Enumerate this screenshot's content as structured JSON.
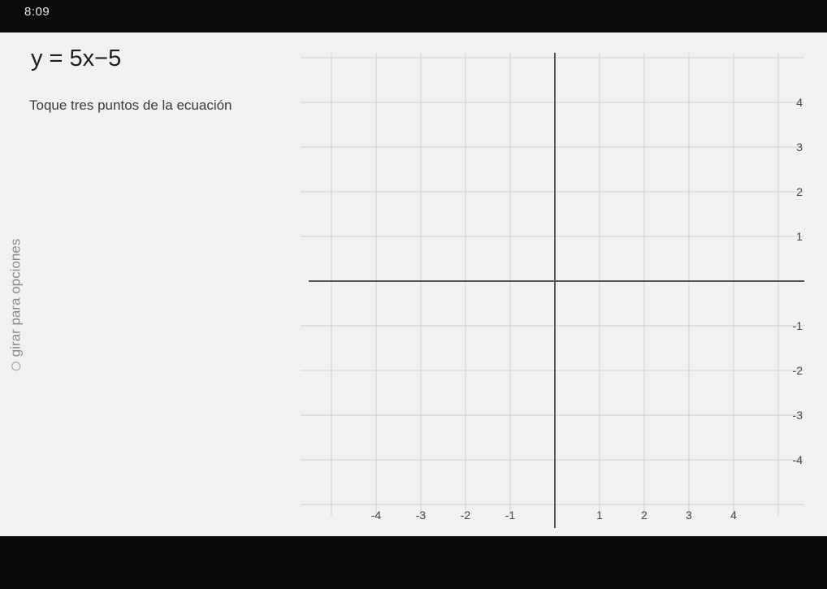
{
  "status_bar": {
    "time": "8:09"
  },
  "problem": {
    "equation": "y = 5x−5",
    "instruction": "Toque tres puntos de la ecuación"
  },
  "hint": {
    "rotate": "girar para opciones",
    "icon": "circle-icon"
  },
  "graph": {
    "x_ticks": [
      "-4",
      "-3",
      "-2",
      "-1",
      "1",
      "2",
      "3",
      "4"
    ],
    "y_ticks": [
      "4",
      "3",
      "2",
      "1",
      "-1",
      "-2",
      "-3",
      "-4"
    ],
    "colors": {
      "grid": "#cfcfcf",
      "axis": "#555555",
      "background": "#f1f1f0"
    }
  }
}
